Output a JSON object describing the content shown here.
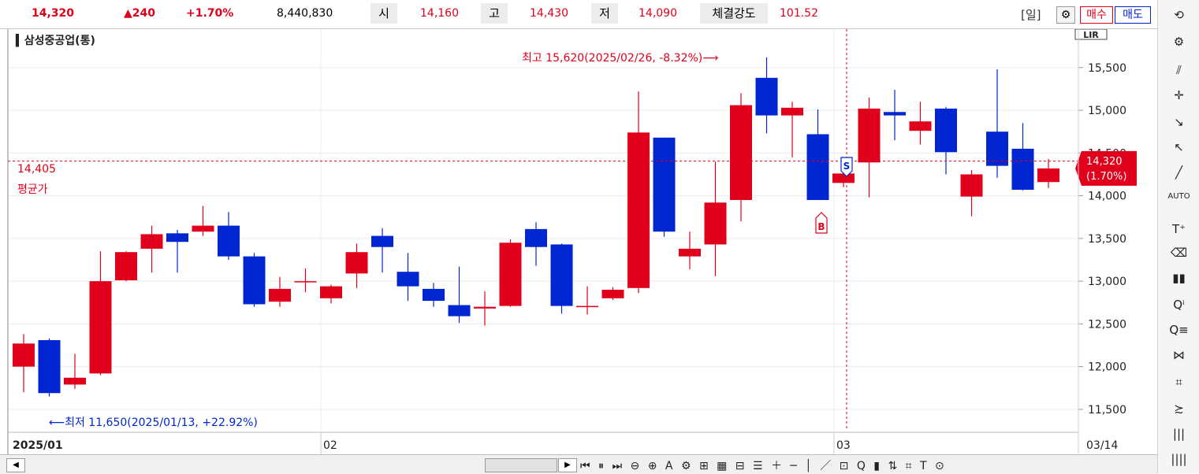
{
  "quote": {
    "price": "14,320",
    "change": "▲240",
    "change_pct": "+1.70%",
    "volume": "8,440,830",
    "open_label": "시",
    "open": "14,160",
    "high_label": "고",
    "high": "14,430",
    "low_label": "저",
    "low": "14,090",
    "strength_label": "체결강도",
    "strength": "101.52"
  },
  "toolbar": {
    "period": "[일]",
    "gear_icon": "gear-icon",
    "buy": "매수",
    "sell": "매도"
  },
  "chart": {
    "title": "삼성중공업(통)",
    "lir": "LIR",
    "high_note": "최고 15,620(2025/02/26, -8.32%)⟶",
    "low_note": "⟵최저 11,650(2025/01/13, +22.92%)",
    "avg_value": "14,405",
    "avg_label": "평균가",
    "current_price": "14,320",
    "current_pct": "(1.70%)",
    "buy_marker": "B",
    "sell_marker": "S",
    "x_labels": [
      "2025/01",
      "02",
      "03",
      "03/14"
    ],
    "colors": {
      "up": "#e0001b",
      "down": "#0026d1"
    }
  },
  "chart_data": {
    "type": "candlestick",
    "y_ticks": [
      11500,
      12000,
      12500,
      13000,
      13500,
      14000,
      14500,
      15000,
      15500
    ],
    "ylim": [
      11250,
      15950
    ],
    "candles": [
      {
        "o": 12000,
        "h": 12380,
        "l": 11700,
        "c": 12270
      },
      {
        "o": 12310,
        "h": 12330,
        "l": 11650,
        "c": 11690
      },
      {
        "o": 11790,
        "h": 12150,
        "l": 11740,
        "c": 11870
      },
      {
        "o": 11920,
        "h": 13350,
        "l": 11900,
        "c": 13000
      },
      {
        "o": 13010,
        "h": 13350,
        "l": 13000,
        "c": 13340
      },
      {
        "o": 13380,
        "h": 13650,
        "l": 13100,
        "c": 13550
      },
      {
        "o": 13560,
        "h": 13600,
        "l": 13100,
        "c": 13460
      },
      {
        "o": 13580,
        "h": 13880,
        "l": 13530,
        "c": 13650
      },
      {
        "o": 13650,
        "h": 13810,
        "l": 13250,
        "c": 13290
      },
      {
        "o": 13290,
        "h": 13330,
        "l": 12700,
        "c": 12730
      },
      {
        "o": 12760,
        "h": 13050,
        "l": 12700,
        "c": 12910
      },
      {
        "o": 13000,
        "h": 13150,
        "l": 12870,
        "c": 13000
      },
      {
        "o": 12800,
        "h": 12960,
        "l": 12740,
        "c": 12940
      },
      {
        "o": 13090,
        "h": 13440,
        "l": 12920,
        "c": 13340
      },
      {
        "o": 13530,
        "h": 13620,
        "l": 13100,
        "c": 13400
      },
      {
        "o": 13110,
        "h": 13330,
        "l": 12770,
        "c": 12940
      },
      {
        "o": 12910,
        "h": 12980,
        "l": 12700,
        "c": 12770
      },
      {
        "o": 12720,
        "h": 13170,
        "l": 12510,
        "c": 12590
      },
      {
        "o": 12680,
        "h": 12880,
        "l": 12480,
        "c": 12700
      },
      {
        "o": 12710,
        "h": 13490,
        "l": 12700,
        "c": 13450
      },
      {
        "o": 13610,
        "h": 13690,
        "l": 13180,
        "c": 13400
      },
      {
        "o": 13430,
        "h": 13440,
        "l": 12620,
        "c": 12710
      },
      {
        "o": 12710,
        "h": 12940,
        "l": 12610,
        "c": 12710
      },
      {
        "o": 12800,
        "h": 12930,
        "l": 12780,
        "c": 12900
      },
      {
        "o": 12920,
        "h": 15220,
        "l": 12860,
        "c": 14740
      },
      {
        "o": 14680,
        "h": 14680,
        "l": 13520,
        "c": 13580
      },
      {
        "o": 13290,
        "h": 13580,
        "l": 13140,
        "c": 13380
      },
      {
        "o": 13430,
        "h": 14400,
        "l": 13060,
        "c": 13920
      },
      {
        "o": 13950,
        "h": 15200,
        "l": 13700,
        "c": 15060
      },
      {
        "o": 15380,
        "h": 15620,
        "l": 14730,
        "c": 14940
      },
      {
        "o": 14940,
        "h": 15100,
        "l": 14450,
        "c": 15030
      },
      {
        "o": 14720,
        "h": 15010,
        "l": 13950,
        "c": 13950
      },
      {
        "o": 14150,
        "h": 14280,
        "l": 14100,
        "c": 14260
      },
      {
        "o": 14390,
        "h": 15150,
        "l": 13980,
        "c": 15020
      },
      {
        "o": 14980,
        "h": 15240,
        "l": 14650,
        "c": 14940
      },
      {
        "o": 14760,
        "h": 15100,
        "l": 14600,
        "c": 14870
      },
      {
        "o": 15020,
        "h": 15040,
        "l": 14250,
        "c": 14510
      },
      {
        "o": 13990,
        "h": 14300,
        "l": 13760,
        "c": 14250
      },
      {
        "o": 14750,
        "h": 15480,
        "l": 14210,
        "c": 14350
      },
      {
        "o": 14550,
        "h": 14850,
        "l": 14060,
        "c": 14070
      },
      {
        "o": 14160,
        "h": 14430,
        "l": 14090,
        "c": 14320
      }
    ]
  }
}
